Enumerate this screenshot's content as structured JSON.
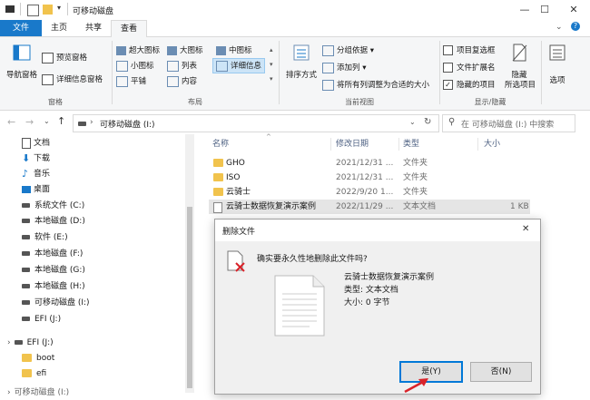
{
  "window": {
    "title": "可移动磁盘",
    "minimize": "—",
    "maximize": "☐",
    "close": "✕"
  },
  "ribbon_tabs": [
    "文件",
    "主页",
    "共享",
    "查看"
  ],
  "ribbon": {
    "panes": {
      "title": "窗格",
      "nav_pane": "导航窗格",
      "preview_pane": "预览窗格",
      "details_pane": "详细信息窗格"
    },
    "layout": {
      "title": "布局",
      "items": [
        "超大图标",
        "大图标",
        "中图标",
        "小图标",
        "列表",
        "详细信息",
        "平铺",
        "内容"
      ]
    },
    "current_view": {
      "title": "当前视图",
      "sort_by": "排序方式",
      "group_by": "分组依据",
      "add_columns": "添加列",
      "size_all_columns": "将所有列调整为合适的大小"
    },
    "show_hide": {
      "title": "显示/隐藏",
      "item_checkboxes": "项目复选框",
      "file_extensions": "文件扩展名",
      "hidden_items": "隐藏的项目",
      "hide_selected": "隐藏\n所选项目",
      "options": "选项",
      "item_checkboxes_checked": false,
      "file_extensions_checked": false,
      "hidden_items_checked": true
    }
  },
  "address_bar": {
    "path_separator": "›",
    "location": "可移动磁盘 (I:)",
    "search_placeholder": "在 可移动磁盘 (I:) 中搜索"
  },
  "nav_pane": {
    "items": [
      {
        "label": "文档",
        "icon": "documents-icon"
      },
      {
        "label": "下载",
        "icon": "download-icon"
      },
      {
        "label": "音乐",
        "icon": "music-icon"
      },
      {
        "label": "桌面",
        "icon": "desktop-icon"
      },
      {
        "label": "系统文件 (C:)",
        "icon": "drive-icon"
      },
      {
        "label": "本地磁盘 (D:)",
        "icon": "drive-icon"
      },
      {
        "label": "软件 (E:)",
        "icon": "drive-icon"
      },
      {
        "label": "本地磁盘 (F:)",
        "icon": "drive-icon"
      },
      {
        "label": "本地磁盘 (G:)",
        "icon": "drive-icon"
      },
      {
        "label": "本地磁盘 (H:)",
        "icon": "drive-icon"
      },
      {
        "label": "可移动磁盘 (I:)",
        "icon": "drive-icon"
      },
      {
        "label": "EFI (J:)",
        "icon": "drive-icon"
      }
    ],
    "efi_root": "EFI (J:)",
    "efi_children": [
      "boot",
      "efi"
    ],
    "partial": "可移动磁盘 (I:)"
  },
  "file_list": {
    "columns": [
      "名称",
      "修改日期",
      "类型",
      "大小"
    ],
    "rows": [
      {
        "name": "GHO",
        "date": "2021/12/31 ...",
        "type": "文件夹",
        "size": "",
        "icon": "folder-icon"
      },
      {
        "name": "ISO",
        "date": "2021/12/31 ...",
        "type": "文件夹",
        "size": "",
        "icon": "folder-icon"
      },
      {
        "name": "云骑士",
        "date": "2022/9/20 1...",
        "type": "文件夹",
        "size": "",
        "icon": "folder-icon"
      },
      {
        "name": "云骑士数据恢复演示案例",
        "date": "2022/11/29 ...",
        "type": "文本文档",
        "size": "1 KB",
        "icon": "text-file-icon"
      }
    ]
  },
  "dialog": {
    "title": "删除文件",
    "close": "✕",
    "question": "确实要永久性地删除此文件吗?",
    "file_name": "云骑士数据恢复演示案例",
    "file_type": "类型: 文本文档",
    "file_size": "大小: 0 字节",
    "yes_label": "是(Y)",
    "no_label": "否(N)"
  },
  "colors": {
    "accent": "#1979ca",
    "selection": "#e5e5e5",
    "focus_border": "#0078d7",
    "arrow": "#d9232a"
  }
}
